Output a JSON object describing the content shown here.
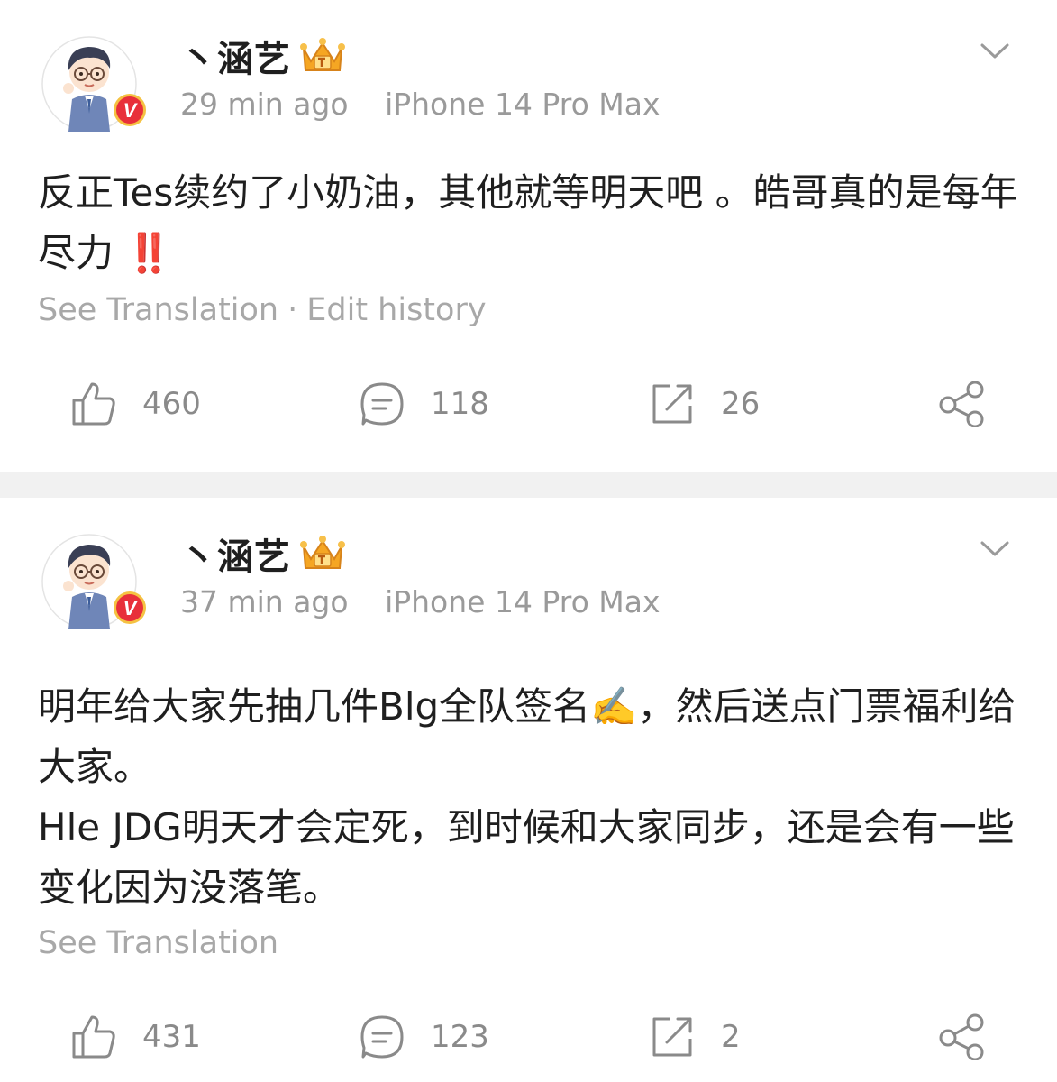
{
  "posts": [
    {
      "username": "丶涵艺",
      "time": "29 min ago",
      "device": "iPhone 14 Pro Max",
      "content_lines": [
        "反正Tes续约了小奶油，其他就等明天吧 。皓哥真的是每年尽力"
      ],
      "emoji": "‼️",
      "see_translation": "See Translation",
      "separator": "·",
      "edit_history": "Edit history",
      "likes": "460",
      "comments": "118",
      "reposts": "26"
    },
    {
      "username": "丶涵艺",
      "time": "37 min ago",
      "device": "iPhone 14 Pro Max",
      "content_lines": [
        "明年给大家先抽几件Blg全队签名✍️，然后送点门票福利给大家。",
        "Hle JDG明天才会定死，到时候和大家同步，还是会有一些变化因为没落笔。"
      ],
      "see_translation": "See Translation",
      "likes": "431",
      "comments": "123",
      "reposts": "2"
    }
  ],
  "icons": {
    "avatar": "cartoon-avatar",
    "verified": "verified-v-badge",
    "crown": "crown-badge-icon",
    "menu": "chevron-down-icon",
    "like": "thumbs-up-icon",
    "comment": "comment-icon",
    "repost": "repost-icon",
    "share": "share-icon"
  },
  "colors": {
    "text": "#1f1f1f",
    "meta": "#9a9a9a",
    "link": "#a8a8a8",
    "divider": "#f1f1f1",
    "badge": "#e8303a",
    "crown": "#f5a623"
  }
}
